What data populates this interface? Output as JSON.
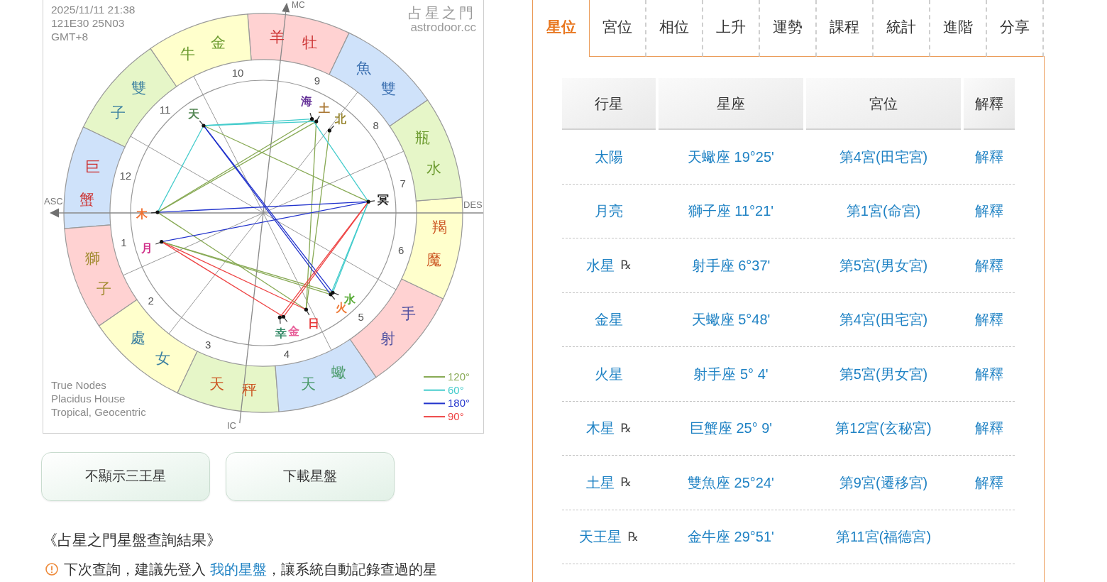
{
  "chart": {
    "info_lines": [
      "2025/11/11 21:38",
      "121E30 25N03",
      "GMT+8"
    ],
    "brand_name": "占星之門",
    "brand_url": "astrodoor.cc",
    "axis_labels": {
      "mc": "MC",
      "asc": "ASC",
      "des": "DES",
      "ic": "IC"
    },
    "signs": [
      {
        "name": "牡羊",
        "kind": "fire",
        "color": "#cc3333"
      },
      {
        "name": "金牛",
        "kind": "earth",
        "color": "#6b9a2e"
      },
      {
        "name": "雙子",
        "kind": "air",
        "color": "#3a7fa0"
      },
      {
        "name": "巨蟹",
        "kind": "water",
        "color": "#cc3333"
      },
      {
        "name": "獅子",
        "kind": "fire",
        "color": "#a08a2e"
      },
      {
        "name": "處女",
        "kind": "earth",
        "color": "#3a7fa0"
      },
      {
        "name": "天秤",
        "kind": "air",
        "color": "#cc5522"
      },
      {
        "name": "天蠍",
        "kind": "water",
        "color": "#4a9a6a"
      },
      {
        "name": "射手",
        "kind": "fire",
        "color": "#5050a0"
      },
      {
        "name": "魔羯",
        "kind": "earth",
        "color": "#cc5522"
      },
      {
        "name": "水瓶",
        "kind": "air",
        "color": "#6b9a2e"
      },
      {
        "name": "雙魚",
        "kind": "water",
        "color": "#3a6fb0"
      }
    ],
    "house_numbers": [
      "1",
      "2",
      "3",
      "4",
      "5",
      "6",
      "7",
      "8",
      "9",
      "10",
      "11",
      "12"
    ],
    "planets": [
      {
        "label": "日",
        "color": "#e83838"
      },
      {
        "label": "月",
        "color": "#d0308a"
      },
      {
        "label": "水",
        "color": "#55aa33"
      },
      {
        "label": "金",
        "color": "#e8609a"
      },
      {
        "label": "火",
        "color": "#ee7733"
      },
      {
        "label": "木",
        "color": "#f07030"
      },
      {
        "label": "土",
        "color": "#aa7733"
      },
      {
        "label": "天",
        "color": "#558855"
      },
      {
        "label": "海",
        "color": "#663399"
      },
      {
        "label": "冥",
        "color": "#222222"
      },
      {
        "label": "北",
        "color": "#998833"
      },
      {
        "label": "幸",
        "color": "#338866"
      }
    ],
    "settings_lines": [
      "True Nodes",
      "Placidus House",
      "Tropical, Geocentric"
    ],
    "legend": [
      {
        "label": "120°",
        "color": "#88aa55"
      },
      {
        "label": "60°",
        "color": "#44cccc"
      },
      {
        "label": "180°",
        "color": "#2233cc"
      },
      {
        "label": "90°",
        "color": "#ee4444"
      }
    ]
  },
  "chart_buttons": [
    {
      "label": "不顯示三王星"
    },
    {
      "label": "下載星盤"
    }
  ],
  "result_heading": "《占星之門星盤查詢結果》",
  "notice": {
    "text_before": "下次查詢，建議先登入",
    "link": "我的星盤",
    "text_after": "，讓系統自動記錄查過的星"
  },
  "tabs": [
    {
      "label": "星位",
      "selected": true
    },
    {
      "label": "宮位",
      "selected": false
    },
    {
      "label": "相位",
      "selected": false
    },
    {
      "label": "上升",
      "selected": false
    },
    {
      "label": "運勢",
      "selected": false
    },
    {
      "label": "課程",
      "selected": false
    },
    {
      "label": "統計",
      "selected": false
    },
    {
      "label": "進階",
      "selected": false
    },
    {
      "label": "分享",
      "selected": false
    }
  ],
  "table": {
    "columns": [
      "行星",
      "星座",
      "宮位",
      "解釋"
    ],
    "rows": [
      {
        "planet": "太陽",
        "sign": "天蠍座 19°25'",
        "house": "第4宮(田宅宮)",
        "explain": "解釋"
      },
      {
        "planet": "月亮",
        "sign": "獅子座 11°21'",
        "house": "第1宮(命宮)",
        "explain": "解釋"
      },
      {
        "planet": "水星",
        "retrograde_mark": "℞",
        "sign": "射手座 6°37'",
        "house": "第5宮(男女宮)",
        "explain": "解釋"
      },
      {
        "planet": "金星",
        "sign": "天蠍座 5°48'",
        "house": "第4宮(田宅宮)",
        "explain": "解釋"
      },
      {
        "planet": "火星",
        "sign": "射手座 5° 4'",
        "house": "第5宮(男女宮)",
        "explain": "解釋"
      },
      {
        "planet": "木星",
        "retrograde_mark": "℞",
        "sign": "巨蟹座 25° 9'",
        "house": "第12宮(玄秘宮)",
        "explain": "解釋"
      },
      {
        "planet": "土星",
        "retrograde_mark": "℞",
        "sign": "雙魚座 25°24'",
        "house": "第9宮(遷移宮)",
        "explain": "解釋"
      },
      {
        "planet": "天王星",
        "retrograde_mark": "℞",
        "sign": "金牛座 29°51'",
        "house": "第11宮(福德宮)"
      }
    ]
  }
}
